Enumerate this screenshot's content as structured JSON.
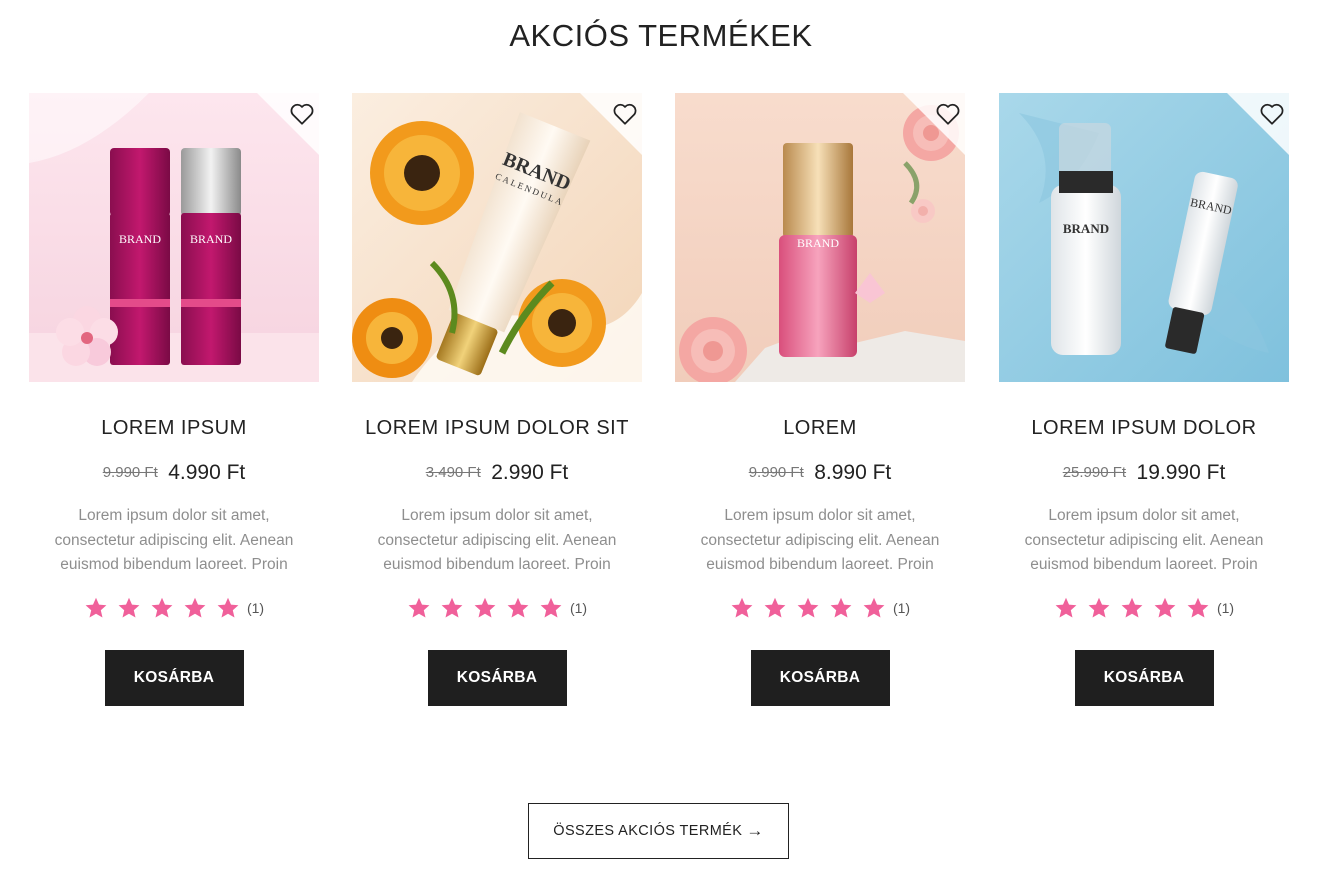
{
  "section": {
    "title": "AKCIÓS TERMÉKEK"
  },
  "products": [
    {
      "name": "LOREM IPSUM",
      "old_price": "9.990 Ft",
      "new_price": "4.990 Ft",
      "description": "Lorem ipsum dolor sit amet, consectetur adipiscing elit. Aenean euismod bibendum laoreet. Proin",
      "rating": 5,
      "review_count": "(1)",
      "cart_label": "KOSÁRBA",
      "image_text": [
        "BRAND",
        "BRAND"
      ]
    },
    {
      "name": "LOREM IPSUM DOLOR SIT",
      "old_price": "3.490 Ft",
      "new_price": "2.990 Ft",
      "description": "Lorem ipsum dolor sit amet, consectetur adipiscing elit. Aenean euismod bibendum laoreet. Proin",
      "rating": 5,
      "review_count": "(1)",
      "cart_label": "KOSÁRBA",
      "image_text": [
        "BRAND",
        "CALENDULA"
      ]
    },
    {
      "name": "LOREM",
      "old_price": "9.990 Ft",
      "new_price": "8.990 Ft",
      "description": "Lorem ipsum dolor sit amet, consectetur adipiscing elit. Aenean euismod bibendum laoreet. Proin",
      "rating": 5,
      "review_count": "(1)",
      "cart_label": "KOSÁRBA",
      "image_text": [
        "BRAND"
      ]
    },
    {
      "name": "LOREM IPSUM DOLOR",
      "old_price": "25.990 Ft",
      "new_price": "19.990 Ft",
      "description": "Lorem ipsum dolor sit amet, consectetur adipiscing elit. Aenean euismod bibendum laoreet. Proin",
      "rating": 5,
      "review_count": "(1)",
      "cart_label": "KOSÁRBA",
      "image_text": [
        "BRAND",
        "BRAND"
      ]
    }
  ],
  "all_button": {
    "label": "ÖSSZES AKCIÓS TERMÉK",
    "arrow": "→"
  },
  "icons": {
    "wishlist": "heart-outline-icon",
    "star": "star-filled-icon"
  },
  "colors": {
    "star": "#f0609a",
    "button_bg": "#1f1f1f",
    "muted_text": "#8e8e8e"
  }
}
